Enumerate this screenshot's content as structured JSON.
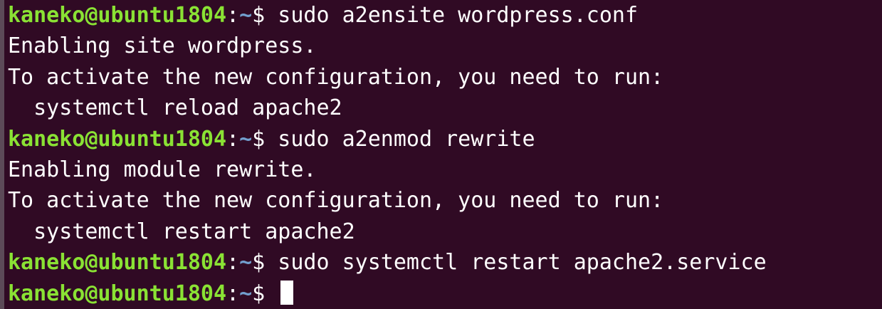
{
  "terminal": {
    "colors": {
      "background": "#300a24",
      "prompt_user": "#8ae234",
      "prompt_path": "#729fcf",
      "text": "#ffffff"
    },
    "lines": [
      {
        "type": "prompt",
        "user_host": "kaneko@ubuntu1804",
        "colon": ":",
        "path": "~",
        "dollar": "$ ",
        "command": "sudo a2ensite wordpress.conf"
      },
      {
        "type": "output",
        "text": "Enabling site wordpress."
      },
      {
        "type": "output",
        "text": "To activate the new configuration, you need to run:"
      },
      {
        "type": "output",
        "text": "  systemctl reload apache2"
      },
      {
        "type": "prompt",
        "user_host": "kaneko@ubuntu1804",
        "colon": ":",
        "path": "~",
        "dollar": "$ ",
        "command": "sudo a2enmod rewrite"
      },
      {
        "type": "output",
        "text": "Enabling module rewrite."
      },
      {
        "type": "output",
        "text": "To activate the new configuration, you need to run:"
      },
      {
        "type": "output",
        "text": "  systemctl restart apache2"
      },
      {
        "type": "prompt",
        "user_host": "kaneko@ubuntu1804",
        "colon": ":",
        "path": "~",
        "dollar": "$ ",
        "command": "sudo systemctl restart apache2.service"
      },
      {
        "type": "prompt",
        "user_host": "kaneko@ubuntu1804",
        "colon": ":",
        "path": "~",
        "dollar": "$ ",
        "command": ""
      }
    ]
  }
}
